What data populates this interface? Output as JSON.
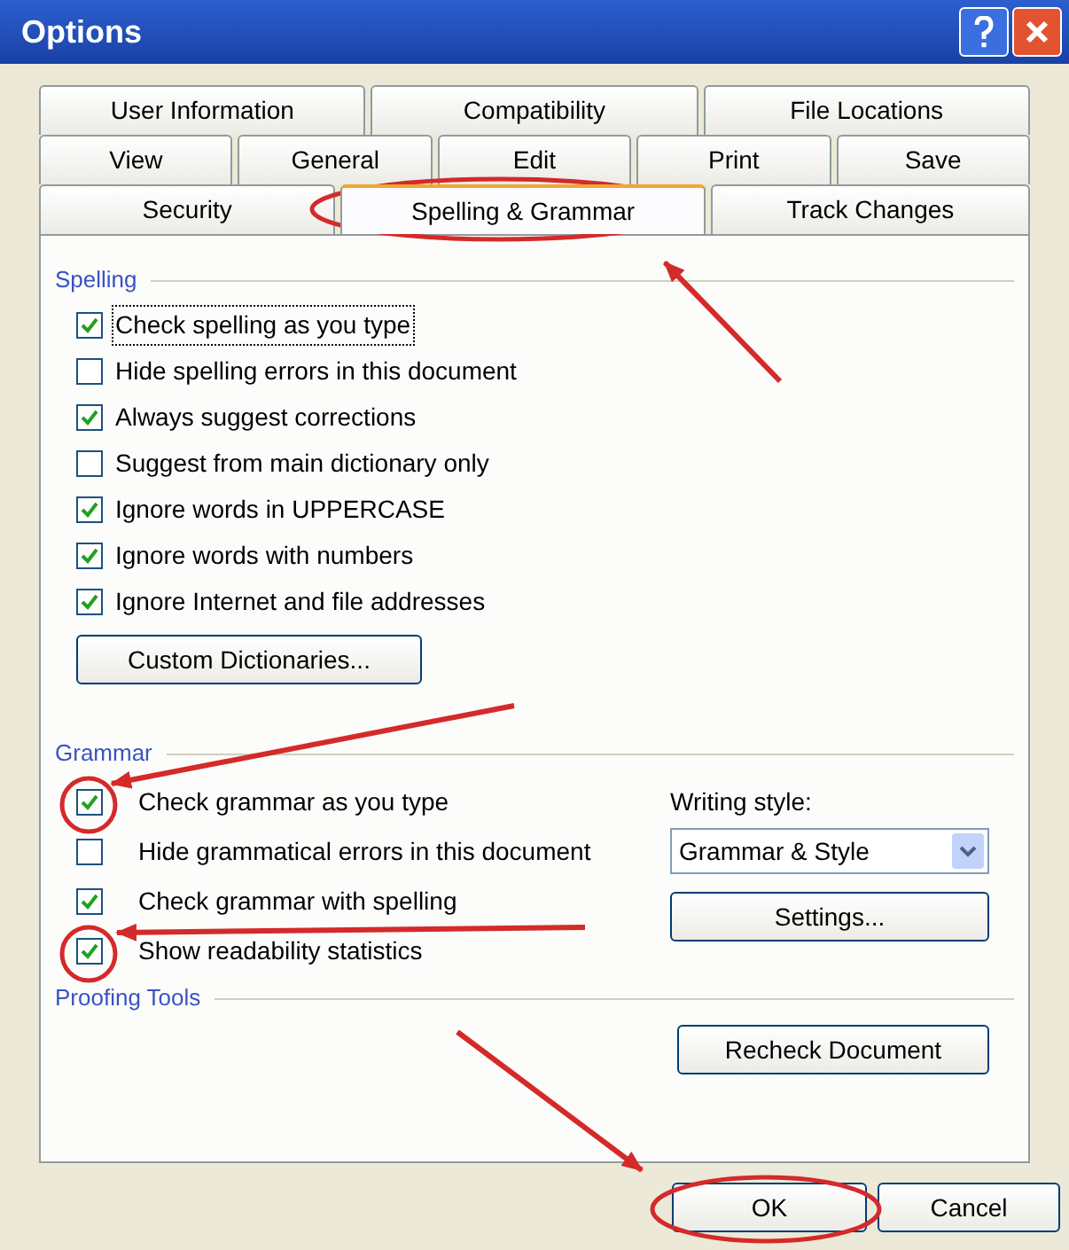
{
  "window": {
    "title": "Options"
  },
  "tab_rows": [
    [
      {
        "label": "User Information",
        "selected": false
      },
      {
        "label": "Compatibility",
        "selected": false
      },
      {
        "label": "File Locations",
        "selected": false
      }
    ],
    [
      {
        "label": "View",
        "selected": false
      },
      {
        "label": "General",
        "selected": false
      },
      {
        "label": "Edit",
        "selected": false
      },
      {
        "label": "Print",
        "selected": false
      },
      {
        "label": "Save",
        "selected": false
      }
    ],
    [
      {
        "label": "Security",
        "selected": false
      },
      {
        "label": "Spelling & Grammar",
        "selected": true
      },
      {
        "label": "Track Changes",
        "selected": false
      }
    ]
  ],
  "spelling": {
    "heading": "Spelling",
    "options": [
      {
        "label": "Check spelling as you type",
        "checked": true,
        "focused": true
      },
      {
        "label": "Hide spelling errors in this document",
        "checked": false,
        "focused": false
      },
      {
        "label": "Always suggest corrections",
        "checked": true,
        "focused": false
      },
      {
        "label": "Suggest from main dictionary only",
        "checked": false,
        "focused": false
      },
      {
        "label": "Ignore words in UPPERCASE",
        "checked": true,
        "focused": false
      },
      {
        "label": "Ignore words with numbers",
        "checked": true,
        "focused": false
      },
      {
        "label": "Ignore Internet and file addresses",
        "checked": true,
        "focused": false
      }
    ],
    "button": "Custom Dictionaries..."
  },
  "grammar": {
    "heading": "Grammar",
    "options": [
      {
        "label": "Check grammar as you type",
        "checked": true,
        "focused": false
      },
      {
        "label": "Hide grammatical errors in this document",
        "checked": false,
        "focused": false
      },
      {
        "label": "Check grammar with spelling",
        "checked": true,
        "focused": false
      },
      {
        "label": "Show readability statistics",
        "checked": true,
        "focused": false
      }
    ],
    "writing_style": {
      "label": "Writing style:",
      "value": "Grammar & Style"
    },
    "button": "Settings..."
  },
  "proofing_tools": {
    "heading": "Proofing Tools",
    "button": "Recheck Document"
  },
  "buttons": [
    "OK",
    "Cancel"
  ]
}
